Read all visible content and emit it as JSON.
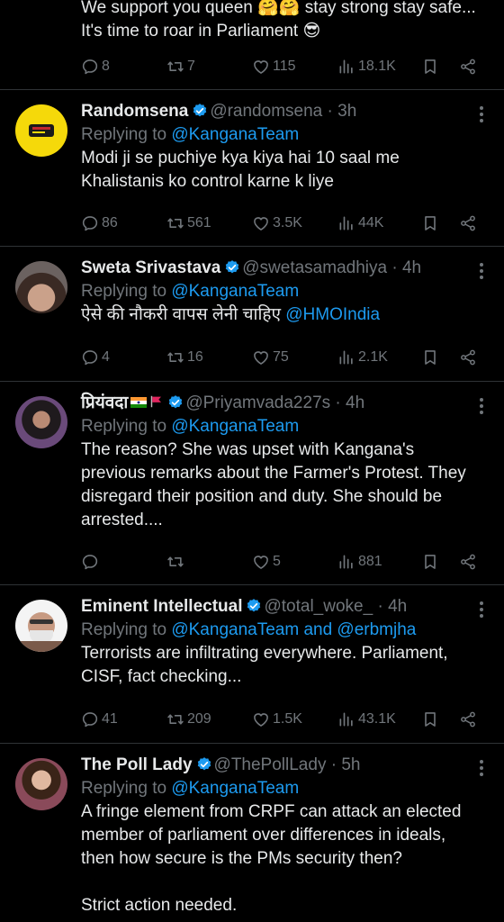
{
  "colors": {
    "background": "#000000",
    "text": "#e7e9ea",
    "muted": "#71767b",
    "link": "#1d9bf0",
    "verified": "#1d9bf0",
    "divider": "#2f3336"
  },
  "top_tweet": {
    "line1": "We support you queen 🤗🤗 stay strong stay safe...",
    "line2": "It's time to roar in Parliament 😎",
    "replies": "8",
    "reposts": "7",
    "likes": "115",
    "views": "18.1K"
  },
  "tweets": [
    {
      "name": "Randomsena",
      "handle": "@randomsena",
      "time": "· 3h",
      "replying_label": "Replying to",
      "replying_to": "@KanganaTeam",
      "lines": [
        "Modi ji se puchiye kya kiya hai 10 saal me",
        "Khalistanis ko control karne k liye"
      ],
      "replies": "86",
      "reposts": "561",
      "likes": "3.5K",
      "views": "44K"
    },
    {
      "name": "Sweta Srivastava",
      "handle": "@swetasamadhiya",
      "time": "· 4h",
      "replying_label": "Replying to",
      "replying_to": "@KanganaTeam",
      "text_plain": "ऐसे की नौकरी वापस लेनी चाहिए ",
      "text_mention": "@HMOIndia",
      "replies": "4",
      "reposts": "16",
      "likes": "75",
      "views": "2.1K"
    },
    {
      "name": "प्रियंवदा",
      "handle": "@Priyamvada227s",
      "time": "· 4h",
      "replying_label": "Replying to",
      "replying_to": "@KanganaTeam",
      "lines": [
        "The reason? She was upset with Kangana's",
        "previous remarks about the Farmer's Protest. They",
        "disregard their position and duty. She should be",
        "arrested...."
      ],
      "replies": "",
      "reposts": "",
      "likes": "5",
      "views": "881"
    },
    {
      "name": "Eminent Intellectual",
      "handle": "@total_woke_",
      "time": "· 4h",
      "replying_label": "Replying to",
      "replying_to": "@KanganaTeam and @erbmjha",
      "lines": [
        "Terrorists are infiltrating everywhere. Parliament,",
        "CISF, fact checking..."
      ],
      "replies": "41",
      "reposts": "209",
      "likes": "1.5K",
      "views": "43.1K"
    },
    {
      "name": "The Poll Lady",
      "handle": "@ThePollLady",
      "time": "· 5h",
      "replying_label": "Replying to",
      "replying_to": "@KanganaTeam",
      "lines": [
        "A fringe element from CRPF can attack an elected",
        "member of parliament over differences in ideals,",
        "then how secure is the PMs security then?",
        "",
        "Strict action needed."
      ]
    }
  ],
  "icons": [
    "reply-icon",
    "repost-icon",
    "like-icon",
    "views-icon",
    "bookmark-icon",
    "share-icon",
    "verified-icon",
    "more-icon"
  ]
}
